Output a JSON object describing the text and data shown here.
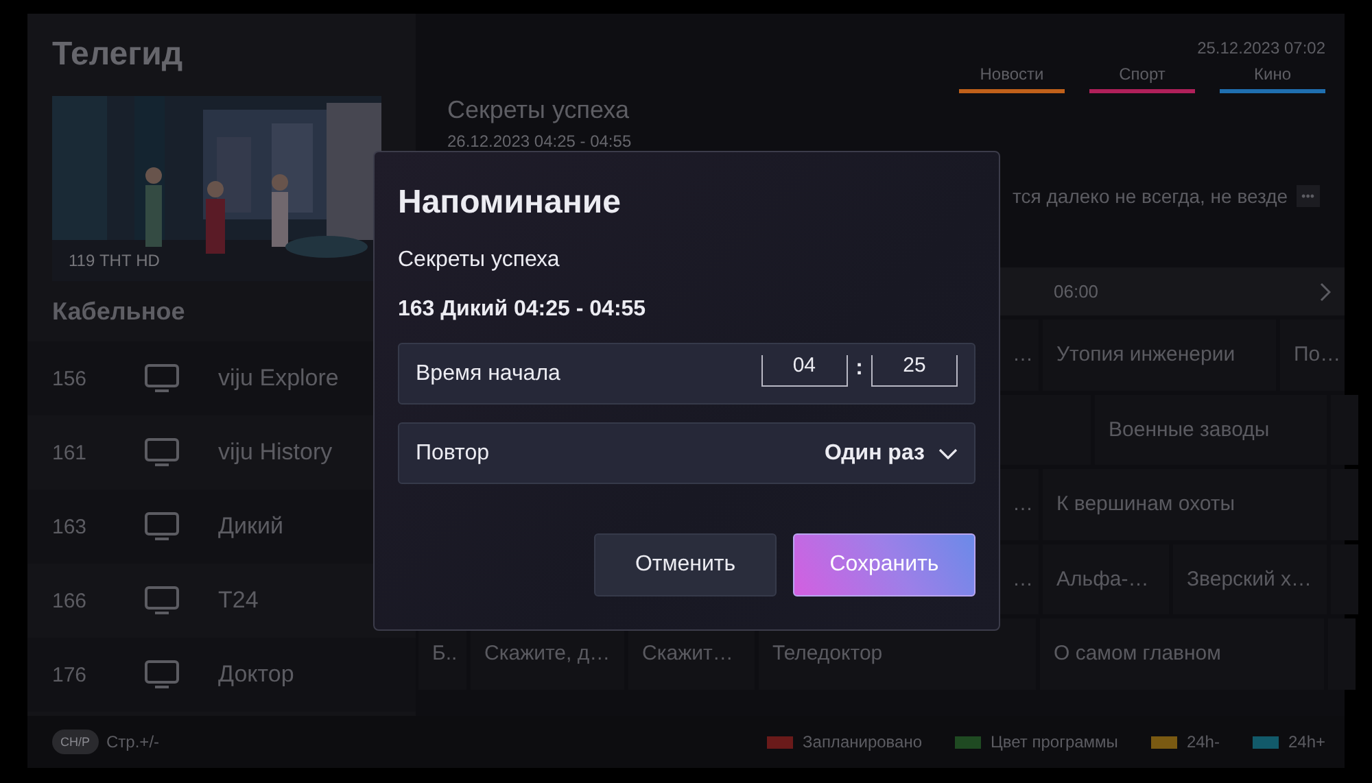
{
  "sidebar": {
    "title": "Телегид",
    "preview": {
      "kind": "picture",
      "caption": "119 ТНТ HD"
    },
    "group": "Кабельное",
    "channels": [
      {
        "number": "156",
        "name": "viju Explore"
      },
      {
        "number": "161",
        "name": "viju History"
      },
      {
        "number": "163",
        "name": "Дикий"
      },
      {
        "number": "166",
        "name": "T24"
      },
      {
        "number": "176",
        "name": "Доктор"
      }
    ]
  },
  "header": {
    "datetime": "25.12.2023 07:02",
    "categories": [
      {
        "label": "Новости",
        "color": "#c0601a"
      },
      {
        "label": "Спорт",
        "color": "#b0205a"
      },
      {
        "label": "Кино",
        "color": "#1f6fb0"
      }
    ]
  },
  "program": {
    "title": "Секреты успеха",
    "time": "26.12.2023 04:25 - 04:55",
    "description": "тся далеко не всегда, не везде",
    "more": "•••"
  },
  "timeline": {
    "time": "06:00"
  },
  "grid": [
    {
      "cells": [
        "…",
        "Утопия инженерии",
        "По…"
      ]
    },
    {
      "cells": [
        "Военные заводы"
      ]
    },
    {
      "cells": [
        "…",
        "К вершинам охоты"
      ]
    },
    {
      "cells": [
        "…",
        "Альфа-…",
        "Зверский х…"
      ]
    },
    {
      "cells": [
        "Б..",
        "Скажите, д…",
        "Скажит…",
        "Теледоктор",
        "О самом главном"
      ]
    }
  ],
  "dialog": {
    "title": "Напоминание",
    "program": "Секреты успеха",
    "details": "163 Дикий 04:25 - 04:55",
    "start": {
      "label": "Время начала",
      "hour": "04",
      "separator": ":",
      "minute": "25"
    },
    "repeat": {
      "label": "Повтор",
      "value": "Один раз"
    },
    "buttons": [
      {
        "label": "Отменить",
        "selected": false
      },
      {
        "label": "Сохранить",
        "selected": true
      }
    ]
  },
  "footer": {
    "key": "CH/P",
    "hint": "Стр.+/-",
    "legend": [
      {
        "label": "Запланировано",
        "color": "#6a1a1a"
      },
      {
        "label": "Цвет программы",
        "color": "#1f4a22"
      },
      {
        "label": "24h-",
        "color": "#7a5a12"
      },
      {
        "label": "24h+",
        "color": "#125a6a"
      }
    ]
  }
}
